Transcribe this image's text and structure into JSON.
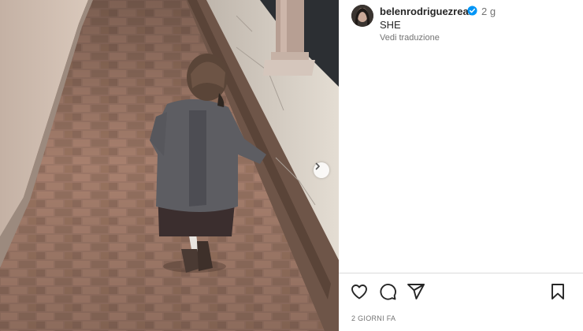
{
  "post": {
    "username": "belenrodriguezreal",
    "time_ago": "2 g",
    "caption": "SHE",
    "translate_link": "Vedi traduzione",
    "date_label": "2 GIORNI FA"
  },
  "icons": {
    "verified": "verified-badge-icon",
    "next": "chevron-right-icon",
    "like": "heart-icon",
    "comment": "comment-icon",
    "share": "paper-plane-icon",
    "save": "bookmark-icon"
  },
  "colors": {
    "verified_blue": "#0095f6",
    "text_primary": "#262626",
    "text_secondary": "#737373",
    "divider": "#dbdbdb"
  }
}
